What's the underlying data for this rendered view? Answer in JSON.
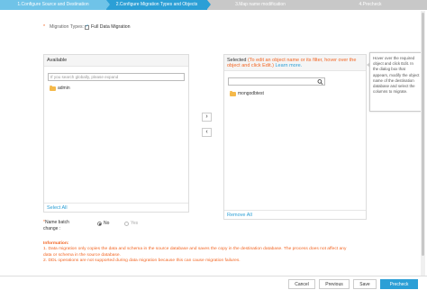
{
  "steps": [
    {
      "label": "1.Configure Source and Destination",
      "state": "done"
    },
    {
      "label": "2.Configure Migration Types and Objects",
      "state": "active"
    },
    {
      "label": "3.Map name modification",
      "state": "pending"
    },
    {
      "label": "4.Precheck",
      "state": "pending"
    }
  ],
  "migration": {
    "required_mark": "*",
    "label": "Migration Types:",
    "option_label": "Full Data Migration",
    "checked": true
  },
  "available": {
    "title": "Available",
    "search_placeholder": "If you search globally, please expand",
    "items": [
      {
        "label": "admin",
        "icon": "folder-icon"
      }
    ],
    "footer_link": "Select All"
  },
  "selected": {
    "title": "Selected",
    "hint": "(To edit an object name or its filter, hover over the object and click Edit.)",
    "learn_more": "Learn more.",
    "items": [
      {
        "label": "mongodbtest",
        "icon": "folder-icon"
      }
    ],
    "footer_link": "Remove All"
  },
  "movers": {
    "right": "›",
    "left": "‹"
  },
  "tooltip": "Hover over the required object and click Edit. In the dialog box that appears, modify the object name of the destination database and select the columns to migrate.",
  "batch": {
    "required_mark": "*",
    "label_line1": "Name batch",
    "label_line2": "change :",
    "options": [
      {
        "label": "No",
        "selected": true
      },
      {
        "label": "Yes",
        "selected": false
      }
    ]
  },
  "info": {
    "title": "Information:",
    "line1": "1. Data migration only copies the data and schema in the source database and saves the copy in the destination database. The process does not affect any",
    "line2": "data or schema in the source database.",
    "line3": "2. DDL operations are not supported during data migration because this can cause migration failures."
  },
  "footer": {
    "cancel": "Cancel",
    "previous": "Previous",
    "save": "Save",
    "precheck": "Precheck"
  },
  "colors": {
    "accent": "#2b9fd6",
    "step_done": "#6fc3e8",
    "step_pending": "#c8c8c8",
    "warning": "#f26522"
  }
}
